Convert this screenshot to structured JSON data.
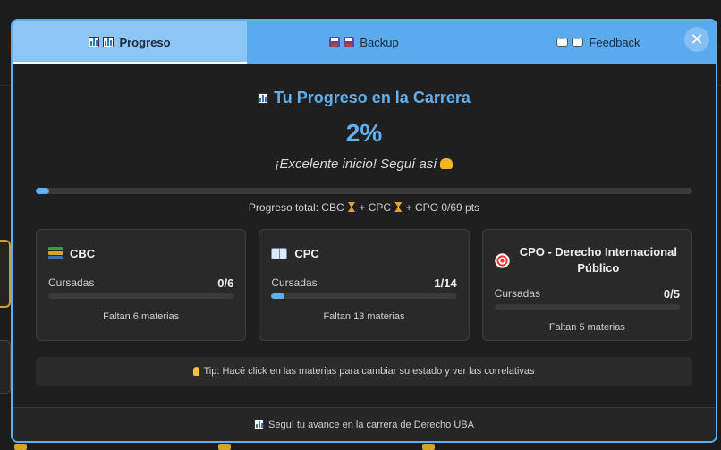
{
  "tabs": [
    {
      "label": "Progreso",
      "icon": "chart-icon",
      "active": true
    },
    {
      "label": "Backup",
      "icon": "floppy-disk-icon",
      "active": false
    },
    {
      "label": "Feedback",
      "icon": "speech-bubble-icon",
      "active": false
    }
  ],
  "close_label": "✕",
  "progress": {
    "title": "Tu Progreso en la Carrera",
    "percent_text": "2%",
    "percent_value": 2,
    "motivation": "¡Excelente inicio! Seguí así",
    "total_prefix": "Progreso total: CBC",
    "total_cpc": " + CPC ",
    "total_suffix": " + CPO 0/69 pts"
  },
  "cards": [
    {
      "name": "CBC",
      "icon": "books-icon",
      "cursadas_label": "Cursadas",
      "count": "0/6",
      "fraction": 0.0,
      "remaining": "Faltan 6 materias"
    },
    {
      "name": "CPC",
      "icon": "open-book-icon",
      "cursadas_label": "Cursadas",
      "count": "1/14",
      "fraction": 0.0714,
      "remaining": "Faltan 13 materias"
    },
    {
      "name": "CPO - Derecho Internacional Público",
      "icon": "target-icon",
      "cursadas_label": "Cursadas",
      "count": "0/5",
      "fraction": 0.0,
      "remaining": "Faltan 5 materias"
    }
  ],
  "tip": "Tip: Hacé click en las materias para cambiar su estado y ver las correlativas",
  "footer": "Seguí tu avance en la carrera de Derecho UBA",
  "colors": {
    "accent": "#5eb0f2",
    "tab_bar": "#5aaaf0",
    "tab_active": "#8cc6f6"
  }
}
